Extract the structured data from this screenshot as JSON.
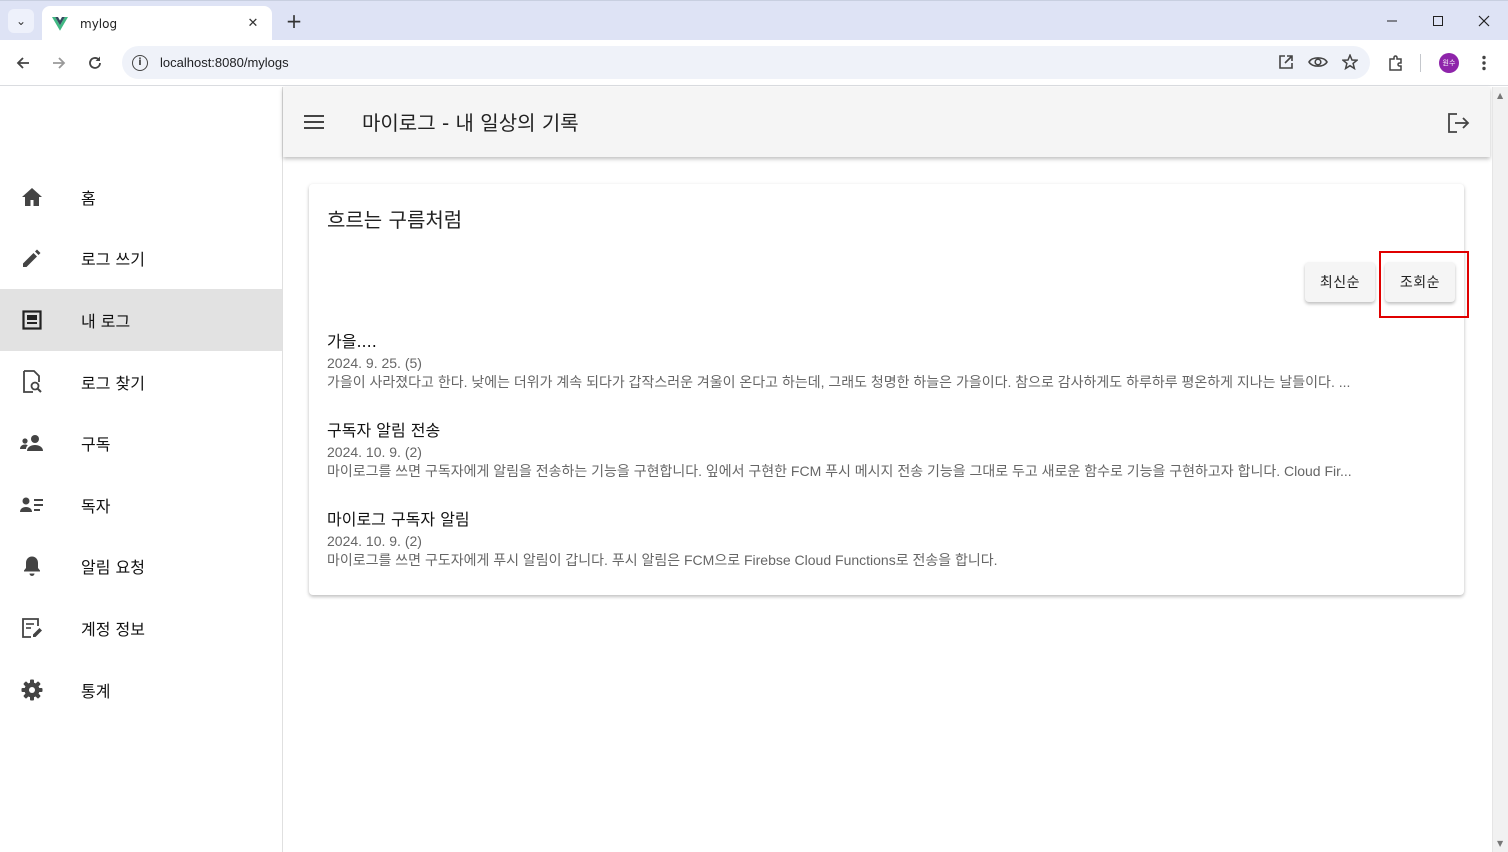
{
  "browser": {
    "tab_title": "mylog",
    "url": "localhost:8080/mylogs",
    "profile_label": "원수",
    "colors": {
      "tabstrip": "#dee3f5",
      "profile": "#8e24aa",
      "vue_green": "#41b883",
      "vue_dark": "#35495e"
    }
  },
  "app": {
    "title": "마이로그 - 내 일상의 기록"
  },
  "sidebar": {
    "items": [
      {
        "label": "홈",
        "icon": "home-icon"
      },
      {
        "label": "로그 쓰기",
        "icon": "pencil-icon"
      },
      {
        "label": "내 로그",
        "icon": "article-icon",
        "active": true
      },
      {
        "label": "로그 찾기",
        "icon": "find-document-icon"
      },
      {
        "label": "구독",
        "icon": "people-icon"
      },
      {
        "label": "독자",
        "icon": "person-list-icon"
      },
      {
        "label": "알림 요청",
        "icon": "bell-icon"
      },
      {
        "label": "계정 정보",
        "icon": "edit-note-icon"
      },
      {
        "label": "통계",
        "icon": "gear-icon"
      }
    ]
  },
  "main": {
    "card_title": "흐르는 구름처럼",
    "sort_latest": "최신순",
    "sort_views": "조회순",
    "posts": [
      {
        "title": "가을....",
        "meta": "2024. 9. 25. (5)",
        "body": "가을이 사라졌다고 한다. 낮에는 더위가 계속 되다가 갑작스러운 겨울이 온다고 하는데, 그래도 청명한 하늘은 가을이다. 참으로 감사하게도 하루하루 평온하게 지나는 날들이다. ..."
      },
      {
        "title": "구독자 알림 전송",
        "meta": "2024. 10. 9. (2)",
        "body": "마이로그를 쓰면 구독자에게 알림을 전송하는 기능을 구현합니다. 잎에서 구현한 FCM 푸시 메시지 전송 기능을 그대로 두고 새로운 함수로 기능을 구현하고자 합니다. Cloud Fir..."
      },
      {
        "title": "마이로그 구독자 알림",
        "meta": "2024. 10. 9. (2)",
        "body": "마이로그를 쓰면 구도자에게 푸시 알림이 갑니다. 푸시 알림은 FCM으로 Firebse Cloud Functions로 전송을 합니다."
      }
    ]
  }
}
